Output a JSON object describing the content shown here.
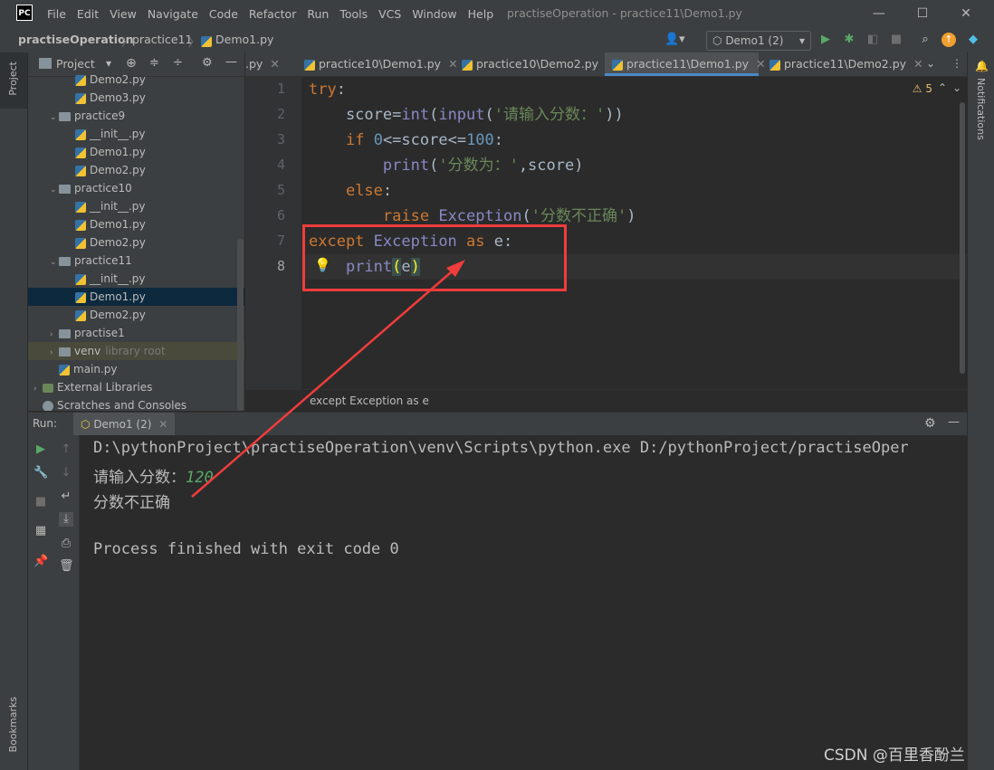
{
  "app": {
    "logo": "PC",
    "window_title": "practiseOperation - practice11\\Demo1.py"
  },
  "menu": [
    "File",
    "Edit",
    "View",
    "Navigate",
    "Code",
    "Refactor",
    "Run",
    "Tools",
    "VCS",
    "Window",
    "Help"
  ],
  "window_controls": {
    "minimize": "—",
    "maximize": "☐",
    "close": "✕"
  },
  "navbar": {
    "project": "practiseOperation",
    "folder": "practice11",
    "file": "Demo1.py",
    "run_config": "Demo1 (2)"
  },
  "project_panel": {
    "title": "Project",
    "tree": [
      {
        "label": "Demo2.py",
        "type": "py",
        "indent": 2
      },
      {
        "label": "Demo3.py",
        "type": "py",
        "indent": 2
      },
      {
        "label": "practice9",
        "type": "dir",
        "indent": 1,
        "expanded": true
      },
      {
        "label": "__init__.py",
        "type": "py",
        "indent": 2
      },
      {
        "label": "Demo1.py",
        "type": "py",
        "indent": 2
      },
      {
        "label": "Demo2.py",
        "type": "py",
        "indent": 2
      },
      {
        "label": "practice10",
        "type": "dir",
        "indent": 1,
        "expanded": true
      },
      {
        "label": "__init__.py",
        "type": "py",
        "indent": 2
      },
      {
        "label": "Demo1.py",
        "type": "py",
        "indent": 2
      },
      {
        "label": "Demo2.py",
        "type": "py",
        "indent": 2
      },
      {
        "label": "practice11",
        "type": "dir",
        "indent": 1,
        "expanded": true
      },
      {
        "label": "__init__.py",
        "type": "py",
        "indent": 2
      },
      {
        "label": "Demo1.py",
        "type": "py",
        "indent": 2,
        "selected": true
      },
      {
        "label": "Demo2.py",
        "type": "py",
        "indent": 2
      },
      {
        "label": "practise1",
        "type": "dir",
        "indent": 1,
        "expanded": false
      },
      {
        "label": "venv",
        "type": "dir",
        "indent": 1,
        "expanded": false,
        "suffix": "library root"
      },
      {
        "label": "main.py",
        "type": "py",
        "indent": 1
      },
      {
        "label": "External Libraries",
        "type": "lib",
        "indent": 0,
        "expanded": false
      },
      {
        "label": "Scratches and Consoles",
        "type": "scr",
        "indent": 0
      }
    ]
  },
  "tabs": [
    {
      "label": ".py"
    },
    {
      "label": "practice10\\Demo1.py"
    },
    {
      "label": "practice10\\Demo2.py"
    },
    {
      "label": "practice11\\Demo1.py",
      "active": true
    },
    {
      "label": "practice11\\Demo2.py"
    }
  ],
  "editor": {
    "warnings": "5",
    "line_numbers": [
      "1",
      "2",
      "3",
      "4",
      "5",
      "6",
      "7",
      "8"
    ],
    "breadcrumb": "except Exception as e"
  },
  "run_panel": {
    "label": "Run:",
    "tab": "Demo1 (2)",
    "command": "D:\\pythonProject\\practiseOperation\\venv\\Scripts\\python.exe D:/pythonProject/practiseOper",
    "prompt": "请输入分数：",
    "input_value": "120",
    "output": "分数不正确",
    "finished": "Process finished with exit code 0"
  },
  "side_labels": {
    "project": "Project",
    "bookmarks": "Bookmarks",
    "notifications": "Notifications"
  },
  "watermark": "CSDN @百里香酚兰",
  "colors": {
    "annotation": "#f03c3c",
    "keyword": "#cc7832",
    "string": "#6a8759",
    "number": "#6897bb"
  }
}
